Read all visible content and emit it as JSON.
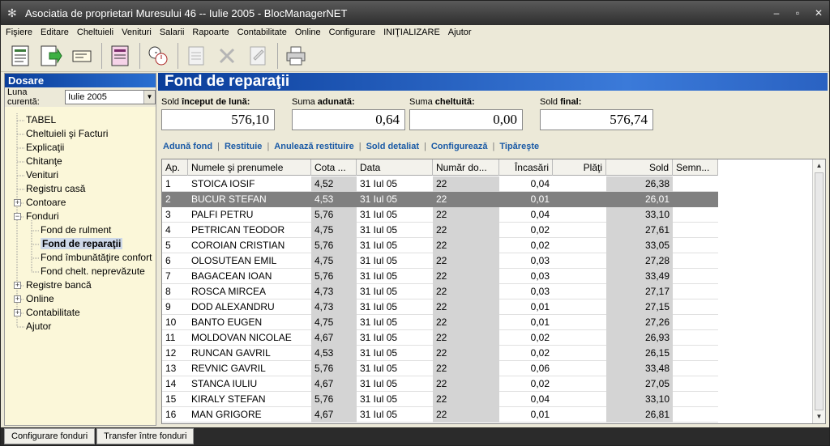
{
  "window": {
    "title": "Asociatia de proprietari Muresului 46 -- Iulie 2005 - BlocManagerNET",
    "minimize": "–",
    "restore": "▫",
    "close": "✕"
  },
  "menu": [
    "Fişiere",
    "Editare",
    "Cheltuieli",
    "Venituri",
    "Salarii",
    "Rapoarte",
    "Contabilitate",
    "Online",
    "Configurare",
    "INIŢIALIZARE",
    "Ajutor"
  ],
  "left": {
    "header": "Dosare",
    "month_label": "Luna curentă:",
    "month_value": "Iulie 2005",
    "tree": [
      {
        "label": "TABEL",
        "level": 0,
        "exp": ""
      },
      {
        "label": "Cheltuieli şi Facturi",
        "level": 0,
        "exp": ""
      },
      {
        "label": "Explicaţii",
        "level": 0,
        "exp": ""
      },
      {
        "label": "Chitanţe",
        "level": 0,
        "exp": ""
      },
      {
        "label": "Venituri",
        "level": 0,
        "exp": ""
      },
      {
        "label": "Registru casă",
        "level": 0,
        "exp": ""
      },
      {
        "label": "Contoare",
        "level": 0,
        "exp": "+"
      },
      {
        "label": "Fonduri",
        "level": 0,
        "exp": "−"
      },
      {
        "label": "Fond de rulment",
        "level": 1,
        "exp": ""
      },
      {
        "label": "Fond de reparaţii",
        "level": 1,
        "exp": "",
        "selected": true
      },
      {
        "label": "Fond îmbunătăţire confort",
        "level": 1,
        "exp": ""
      },
      {
        "label": "Fond chelt. neprevăzute",
        "level": 1,
        "exp": ""
      },
      {
        "label": "Registre bancă",
        "level": 0,
        "exp": "+"
      },
      {
        "label": "Online",
        "level": 0,
        "exp": "+"
      },
      {
        "label": "Contabilitate",
        "level": 0,
        "exp": "+"
      },
      {
        "label": "Ajutor",
        "level": 0,
        "exp": ""
      }
    ]
  },
  "main": {
    "title": "Fond de reparaţii",
    "summary": [
      {
        "label_pre": "Sold ",
        "label_bold": "început de lună:",
        "value": "576,10"
      },
      {
        "label_pre": "Suma ",
        "label_bold": "adunată:",
        "value": "0,64"
      },
      {
        "label_pre": "Suma ",
        "label_bold": "cheltuită:",
        "value": "0,00"
      },
      {
        "label_pre": "Sold ",
        "label_bold": "final:",
        "value": "576,74"
      }
    ],
    "links": [
      "Adună fond",
      "Restituie",
      "Anulează restituire",
      "Sold detaliat",
      "Configurează",
      "Tipăreşte"
    ],
    "columns": [
      "Ap.",
      "Numele şi prenumele",
      "Cota ...",
      "Data",
      "Număr do...",
      "Încasări",
      "Plăţi",
      "Sold",
      "Semn..."
    ],
    "rows": [
      [
        "1",
        "STOICA IOSIF",
        "4,52",
        "31 Iul 05",
        "22",
        "0,04",
        "",
        "26,38",
        ""
      ],
      [
        "2",
        "BUCUR STEFAN",
        "4,53",
        "31 Iul 05",
        "22",
        "0,01",
        "",
        "26,01",
        ""
      ],
      [
        "3",
        "PALFI PETRU",
        "5,76",
        "31 Iul 05",
        "22",
        "0,04",
        "",
        "33,10",
        ""
      ],
      [
        "4",
        "PETRICAN TEODOR",
        "4,75",
        "31 Iul 05",
        "22",
        "0,02",
        "",
        "27,61",
        ""
      ],
      [
        "5",
        "COROIAN CRISTIAN",
        "5,76",
        "31 Iul 05",
        "22",
        "0,02",
        "",
        "33,05",
        ""
      ],
      [
        "6",
        "OLOSUTEAN EMIL",
        "4,75",
        "31 Iul 05",
        "22",
        "0,03",
        "",
        "27,28",
        ""
      ],
      [
        "7",
        "BAGACEAN IOAN",
        "5,76",
        "31 Iul 05",
        "22",
        "0,03",
        "",
        "33,49",
        ""
      ],
      [
        "8",
        "ROSCA MIRCEA",
        "4,73",
        "31 Iul 05",
        "22",
        "0,03",
        "",
        "27,17",
        ""
      ],
      [
        "9",
        "DOD ALEXANDRU",
        "4,73",
        "31 Iul 05",
        "22",
        "0,01",
        "",
        "27,15",
        ""
      ],
      [
        "10",
        "BANTO EUGEN",
        "4,75",
        "31 Iul 05",
        "22",
        "0,01",
        "",
        "27,26",
        ""
      ],
      [
        "11",
        "MOLDOVAN NICOLAE",
        "4,67",
        "31 Iul 05",
        "22",
        "0,02",
        "",
        "26,93",
        ""
      ],
      [
        "12",
        "RUNCAN GAVRIL",
        "4,53",
        "31 Iul 05",
        "22",
        "0,02",
        "",
        "26,15",
        ""
      ],
      [
        "13",
        "REVNIC GAVRIL",
        "5,76",
        "31 Iul 05",
        "22",
        "0,06",
        "",
        "33,48",
        ""
      ],
      [
        "14",
        "STANCA IULIU",
        "4,67",
        "31 Iul 05",
        "22",
        "0,02",
        "",
        "27,05",
        ""
      ],
      [
        "15",
        "KIRALY STEFAN",
        "5,76",
        "31 Iul 05",
        "22",
        "0,04",
        "",
        "33,10",
        ""
      ],
      [
        "16",
        "MAN GRIGORE",
        "4,67",
        "31 Iul 05",
        "22",
        "0,01",
        "",
        "26,81",
        ""
      ]
    ],
    "selected_row": 1
  },
  "status_tabs": [
    "Configurare fonduri",
    "Transfer între fonduri"
  ]
}
